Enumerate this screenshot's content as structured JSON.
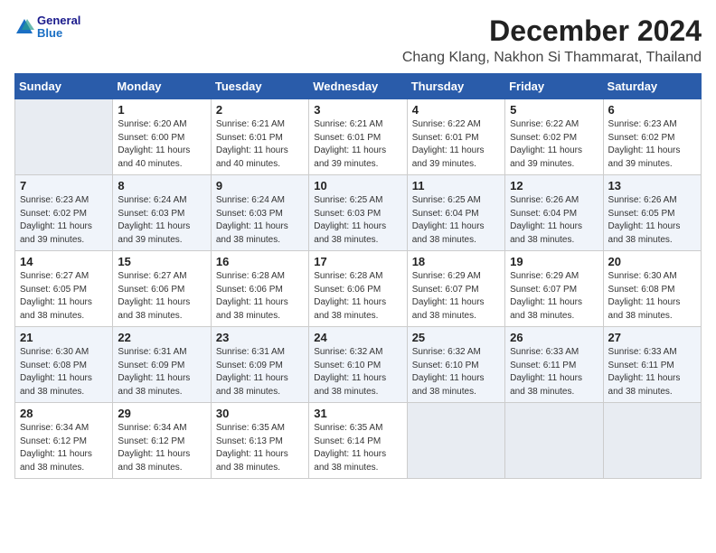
{
  "header": {
    "logo_general": "General",
    "logo_blue": "Blue",
    "title": "December 2024",
    "subtitle": "Chang Klang, Nakhon Si Thammarat, Thailand"
  },
  "calendar": {
    "columns": [
      "Sunday",
      "Monday",
      "Tuesday",
      "Wednesday",
      "Thursday",
      "Friday",
      "Saturday"
    ],
    "weeks": [
      [
        {
          "day": "",
          "info": ""
        },
        {
          "day": "1",
          "info": "Sunrise: 6:20 AM\nSunset: 6:00 PM\nDaylight: 11 hours\nand 40 minutes."
        },
        {
          "day": "2",
          "info": "Sunrise: 6:21 AM\nSunset: 6:01 PM\nDaylight: 11 hours\nand 40 minutes."
        },
        {
          "day": "3",
          "info": "Sunrise: 6:21 AM\nSunset: 6:01 PM\nDaylight: 11 hours\nand 39 minutes."
        },
        {
          "day": "4",
          "info": "Sunrise: 6:22 AM\nSunset: 6:01 PM\nDaylight: 11 hours\nand 39 minutes."
        },
        {
          "day": "5",
          "info": "Sunrise: 6:22 AM\nSunset: 6:02 PM\nDaylight: 11 hours\nand 39 minutes."
        },
        {
          "day": "6",
          "info": "Sunrise: 6:23 AM\nSunset: 6:02 PM\nDaylight: 11 hours\nand 39 minutes."
        },
        {
          "day": "7",
          "info": "Sunrise: 6:23 AM\nSunset: 6:02 PM\nDaylight: 11 hours\nand 39 minutes."
        }
      ],
      [
        {
          "day": "8",
          "info": "Sunrise: 6:24 AM\nSunset: 6:03 PM\nDaylight: 11 hours\nand 39 minutes."
        },
        {
          "day": "9",
          "info": "Sunrise: 6:24 AM\nSunset: 6:03 PM\nDaylight: 11 hours\nand 38 minutes."
        },
        {
          "day": "10",
          "info": "Sunrise: 6:25 AM\nSunset: 6:03 PM\nDaylight: 11 hours\nand 38 minutes."
        },
        {
          "day": "11",
          "info": "Sunrise: 6:25 AM\nSunset: 6:04 PM\nDaylight: 11 hours\nand 38 minutes."
        },
        {
          "day": "12",
          "info": "Sunrise: 6:26 AM\nSunset: 6:04 PM\nDaylight: 11 hours\nand 38 minutes."
        },
        {
          "day": "13",
          "info": "Sunrise: 6:26 AM\nSunset: 6:05 PM\nDaylight: 11 hours\nand 38 minutes."
        },
        {
          "day": "14",
          "info": "Sunrise: 6:27 AM\nSunset: 6:05 PM\nDaylight: 11 hours\nand 38 minutes."
        }
      ],
      [
        {
          "day": "15",
          "info": "Sunrise: 6:27 AM\nSunset: 6:06 PM\nDaylight: 11 hours\nand 38 minutes."
        },
        {
          "day": "16",
          "info": "Sunrise: 6:28 AM\nSunset: 6:06 PM\nDaylight: 11 hours\nand 38 minutes."
        },
        {
          "day": "17",
          "info": "Sunrise: 6:28 AM\nSunset: 6:06 PM\nDaylight: 11 hours\nand 38 minutes."
        },
        {
          "day": "18",
          "info": "Sunrise: 6:29 AM\nSunset: 6:07 PM\nDaylight: 11 hours\nand 38 minutes."
        },
        {
          "day": "19",
          "info": "Sunrise: 6:29 AM\nSunset: 6:07 PM\nDaylight: 11 hours\nand 38 minutes."
        },
        {
          "day": "20",
          "info": "Sunrise: 6:30 AM\nSunset: 6:08 PM\nDaylight: 11 hours\nand 38 minutes."
        },
        {
          "day": "21",
          "info": "Sunrise: 6:30 AM\nSunset: 6:08 PM\nDaylight: 11 hours\nand 38 minutes."
        }
      ],
      [
        {
          "day": "22",
          "info": "Sunrise: 6:31 AM\nSunset: 6:09 PM\nDaylight: 11 hours\nand 38 minutes."
        },
        {
          "day": "23",
          "info": "Sunrise: 6:31 AM\nSunset: 6:09 PM\nDaylight: 11 hours\nand 38 minutes."
        },
        {
          "day": "24",
          "info": "Sunrise: 6:32 AM\nSunset: 6:10 PM\nDaylight: 11 hours\nand 38 minutes."
        },
        {
          "day": "25",
          "info": "Sunrise: 6:32 AM\nSunset: 6:10 PM\nDaylight: 11 hours\nand 38 minutes."
        },
        {
          "day": "26",
          "info": "Sunrise: 6:33 AM\nSunset: 6:11 PM\nDaylight: 11 hours\nand 38 minutes."
        },
        {
          "day": "27",
          "info": "Sunrise: 6:33 AM\nSunset: 6:11 PM\nDaylight: 11 hours\nand 38 minutes."
        },
        {
          "day": "28",
          "info": "Sunrise: 6:34 AM\nSunset: 6:12 PM\nDaylight: 11 hours\nand 38 minutes."
        }
      ],
      [
        {
          "day": "29",
          "info": "Sunrise: 6:34 AM\nSunset: 6:12 PM\nDaylight: 11 hours\nand 38 minutes."
        },
        {
          "day": "30",
          "info": "Sunrise: 6:35 AM\nSunset: 6:13 PM\nDaylight: 11 hours\nand 38 minutes."
        },
        {
          "day": "31",
          "info": "Sunrise: 6:35 AM\nSunset: 6:14 PM\nDaylight: 11 hours\nand 38 minutes."
        },
        {
          "day": "",
          "info": ""
        },
        {
          "day": "",
          "info": ""
        },
        {
          "day": "",
          "info": ""
        },
        {
          "day": "",
          "info": ""
        }
      ]
    ]
  }
}
